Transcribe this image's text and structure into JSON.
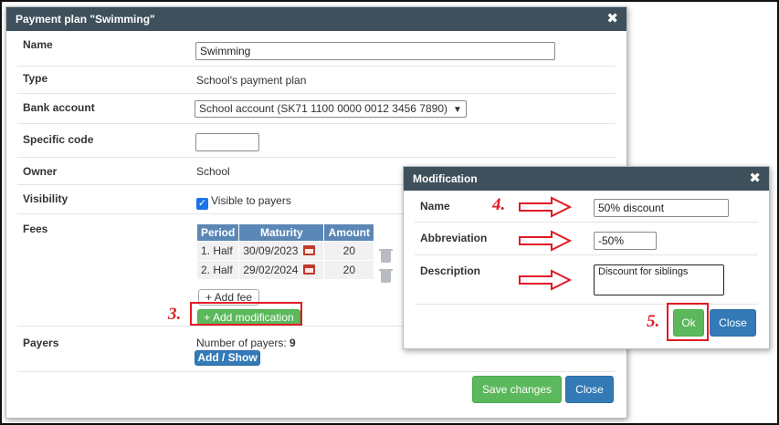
{
  "main_dialog": {
    "title": "Payment plan \"Swimming\"",
    "close": "✖",
    "name_label": "Name",
    "name_value": "Swimming",
    "type_label": "Type",
    "type_value": "School's payment plan",
    "bank_label": "Bank account",
    "bank_value": "School account (SK71 1100 0000 0012 3456 7890)",
    "specific_code_label": "Specific code",
    "specific_code_value": "",
    "owner_label": "Owner",
    "owner_value": "School",
    "visibility_label": "Visibility",
    "visibility_value": "Visible to payers",
    "visibility_checked": true,
    "fees_label": "Fees",
    "fees_table": {
      "headers": [
        "Period",
        "Maturity",
        "Amount"
      ],
      "rows": [
        {
          "period": "1. Half",
          "maturity": "30/09/2023",
          "amount": "20"
        },
        {
          "period": "2. Half",
          "maturity": "29/02/2024",
          "amount": "20"
        }
      ]
    },
    "add_fee": "+ Add fee",
    "add_modification": "+ Add modification",
    "payers_label": "Payers",
    "payers_count_text": "Number of payers: ",
    "payers_count": "9",
    "add_show": "Add / Show",
    "save_changes": "Save changes",
    "close_button": "Close"
  },
  "modification_dialog": {
    "title": "Modification",
    "close": "✖",
    "name_label": "Name",
    "name_value": "50% discount",
    "abbreviation_label": "Abbreviation",
    "abbreviation_value": "-50%",
    "description_label": "Description",
    "description_value": "Discount for siblings",
    "ok": "Ok",
    "close_button": "Close"
  },
  "annotations": {
    "step3": "3.",
    "step4": "4.",
    "step5": "5.",
    "color": "#e01b24"
  },
  "colors": {
    "header": "#3e505b",
    "table_header": "#5b87b6",
    "blue_button": "#337ab7",
    "green_button": "#5cb85c"
  }
}
